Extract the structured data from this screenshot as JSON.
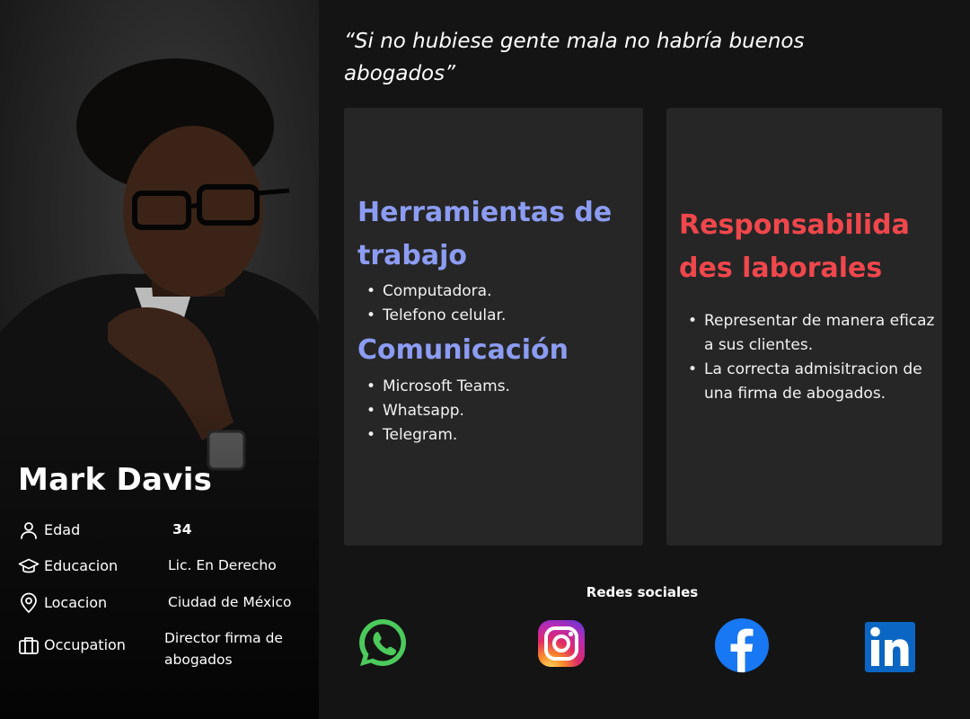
{
  "profile": {
    "name": "Mark Davis",
    "details": [
      {
        "label": "Edad",
        "value": "34",
        "icon": "user-icon"
      },
      {
        "label": "Educacion",
        "value": "Lic. En Derecho",
        "icon": "graduation-cap-icon"
      },
      {
        "label": "Locacion",
        "value": "Ciudad de México",
        "icon": "location-pin-icon"
      },
      {
        "label": "Occupation",
        "value": "Director firma de abogados",
        "icon": "briefcase-icon"
      }
    ]
  },
  "quote": "“Si no hubiese gente mala no habría buenos abogados”",
  "tools_card": {
    "tools_title": "Herramientas de trabajo",
    "tools": [
      "Computadora.",
      "Telefono celular."
    ],
    "comm_title": "Comunicación",
    "comm": [
      "Microsoft Teams.",
      "Whatsapp.",
      "Telegram."
    ]
  },
  "resp_card": {
    "title": "Responsabilidades laborales",
    "title_lines": [
      "Responsabilida",
      "des laborales"
    ],
    "items": [
      "Representar de manera eficaz a sus clientes.",
      "La correcta admisitracion de una firma de abogados."
    ]
  },
  "social": {
    "title": "Redes sociales",
    "links": [
      {
        "name": "WhatsApp",
        "icon": "whatsapp-icon"
      },
      {
        "name": "Instagram",
        "icon": "instagram-icon"
      },
      {
        "name": "Facebook",
        "icon": "facebook-icon"
      },
      {
        "name": "LinkedIn",
        "icon": "linkedin-icon"
      }
    ]
  },
  "colors": {
    "background": "#141414",
    "card": "#262626",
    "tools_heading": "#8c9cf2",
    "resp_heading": "#f0474c"
  }
}
